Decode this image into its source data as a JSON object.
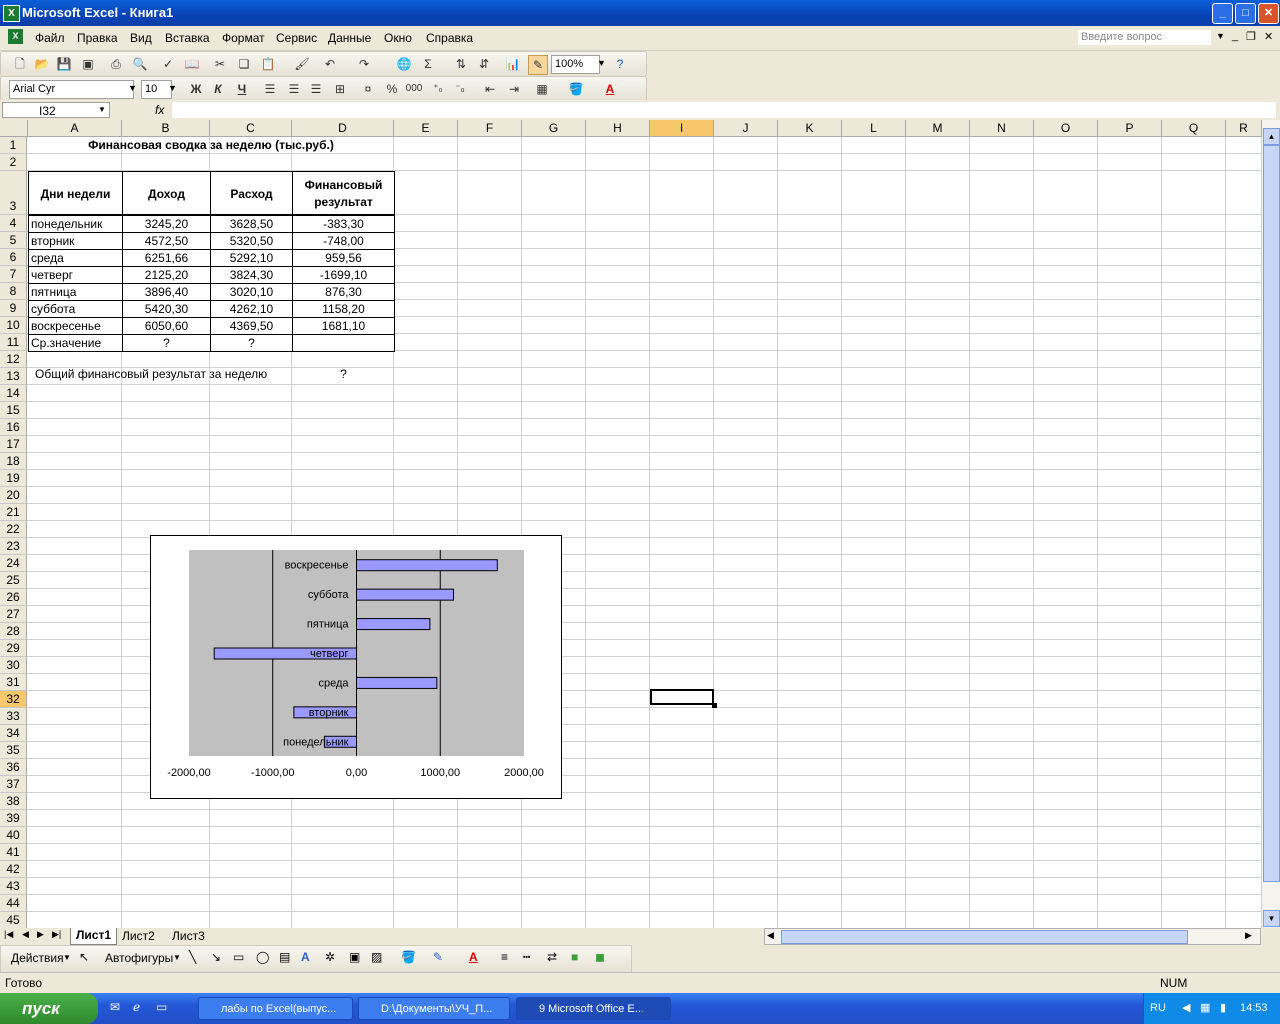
{
  "window": {
    "title": "Microsoft Excel - Книга1",
    "app_icon": "excel-icon",
    "buttons": [
      "minimize",
      "maximize",
      "close"
    ]
  },
  "menu": {
    "items": [
      "Файл",
      "Правка",
      "Вид",
      "Вставка",
      "Формат",
      "Сервис",
      "Данные",
      "Окно",
      "Справка"
    ],
    "ask_placeholder": "Введите вопрос"
  },
  "toolbar": {
    "zoom": "100%",
    "font": "Arial Cyr",
    "font_size": "10",
    "bold": "Ж",
    "italic": "К",
    "underline": "Ч",
    "percent": "%",
    "thousands": "000",
    "sigma": "Σ"
  },
  "formula_bar": {
    "name_box": "I32",
    "fx": "fx",
    "content": ""
  },
  "columns": [
    "A",
    "B",
    "C",
    "D",
    "E",
    "F",
    "G",
    "H",
    "I",
    "J",
    "K",
    "L",
    "M",
    "N",
    "O",
    "P",
    "Q",
    "R"
  ],
  "selected_cell": {
    "column": "I",
    "row": 32
  },
  "sheet": {
    "title": "Финансовая сводка за неделю (тыс.руб.)",
    "headers": [
      "Дни недели",
      "Доход",
      "Расход",
      "Финансовый результат"
    ],
    "rows": [
      [
        "понедельник",
        "3245,20",
        "3628,50",
        "-383,30"
      ],
      [
        "вторник",
        "4572,50",
        "5320,50",
        "-748,00"
      ],
      [
        "среда",
        "6251,66",
        "5292,10",
        "959,56"
      ],
      [
        "четверг",
        "2125,20",
        "3824,30",
        "-1699,10"
      ],
      [
        "пятница",
        "3896,40",
        "3020,10",
        "876,30"
      ],
      [
        "суббота",
        "5420,30",
        "4262,10",
        "1158,20"
      ],
      [
        "воскресенье",
        "6050,60",
        "4369,50",
        "1681,10"
      ]
    ],
    "avg_row": [
      "Ср.значение",
      "?",
      "?",
      ""
    ],
    "total_label": "Общий финансовый результат за неделю",
    "total_value": "?"
  },
  "chart_data": {
    "type": "bar",
    "orientation": "horizontal",
    "categories": [
      "понедельник",
      "вторник",
      "среда",
      "четверг",
      "пятница",
      "суббота",
      "воскресенье"
    ],
    "values": [
      -383.3,
      -748.0,
      959.56,
      -1699.1,
      876.3,
      1158.2,
      1681.1
    ],
    "xlim": [
      -2000,
      2000
    ],
    "tick_labels": [
      "-2000,00",
      "-1000,00",
      "0,00",
      "1000,00",
      "2000,00"
    ],
    "tick_values": [
      -2000,
      -1000,
      0,
      1000,
      2000
    ],
    "bar_color": "#9999ff",
    "plot_bg": "#c0c0c0",
    "grid": true,
    "legend": "none"
  },
  "sheet_tabs": [
    "Лист1",
    "Лист2",
    "Лист3"
  ],
  "active_tab": "Лист1",
  "drawing_toolbar": {
    "actions": "Действия",
    "autoshapes": "Автофигуры"
  },
  "status": {
    "left": "Готово",
    "right": "NUM"
  },
  "taskbar": {
    "start": "пуск",
    "buttons": [
      "лабы по Excel(выпус...",
      "D:\\Документы\\УЧ_П...",
      "9 Microsoft Office E..."
    ],
    "lang": "RU",
    "clock": "14:53"
  }
}
